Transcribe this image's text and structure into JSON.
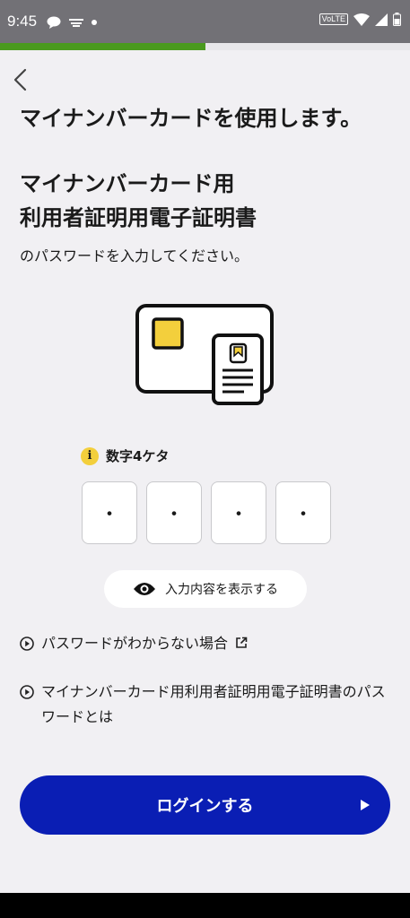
{
  "status_bar": {
    "time": "9:45",
    "left_icons": [
      "line-icon",
      "notification-icon",
      "dot-icon"
    ],
    "right_icons": [
      "volte-icon",
      "wifi-icon",
      "signal-icon",
      "battery-icon"
    ],
    "volte_label": "VoLTE"
  },
  "progress": {
    "fraction": 0.5,
    "color": "#4a9a1e"
  },
  "header": {
    "title": "マイナンバーカードを使用します。"
  },
  "subtitle": {
    "line1": "マイナンバーカード用",
    "line2": "利用者証明用電子証明書"
  },
  "instruction": "のパスワードを入力してください。",
  "pin": {
    "hint_icon": "i",
    "hint_label": "数字4ケタ",
    "slots": [
      "・",
      "・",
      "・",
      "・"
    ]
  },
  "show_toggle": {
    "label": "入力内容を表示する",
    "icon": "eye-icon"
  },
  "links": [
    {
      "label": "パスワードがわからない場合",
      "icon": "play-circle-icon",
      "trailing_icon": "external-link-icon"
    },
    {
      "label": "マイナンバーカード用利用者証明用電子証明書のパスワードとは",
      "icon": "play-circle-icon"
    }
  ],
  "login_button": {
    "label": "ログインする",
    "color": "#0a1eb4"
  },
  "colors": {
    "background": "#f1f0f3",
    "accent_yellow": "#f3cf3c"
  }
}
